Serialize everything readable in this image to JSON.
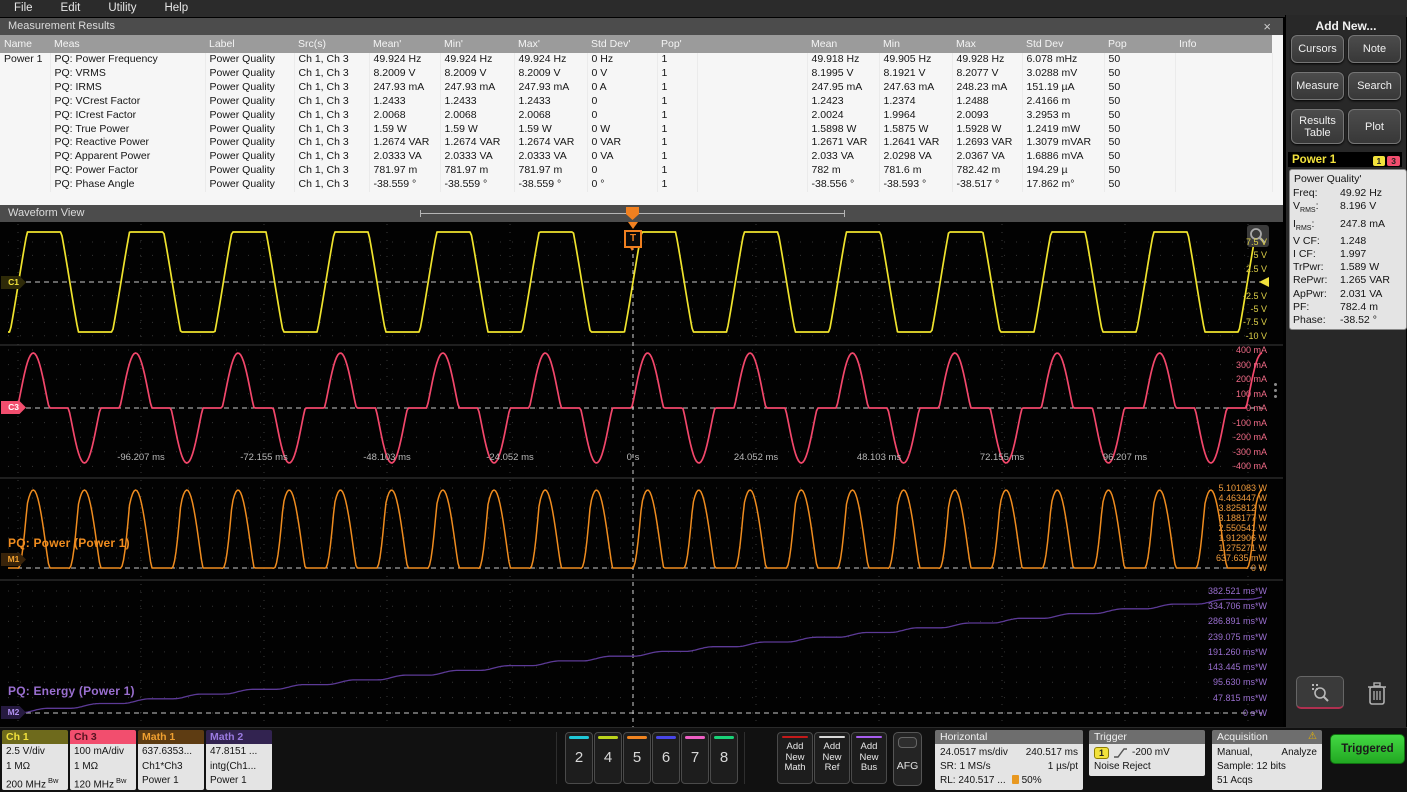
{
  "menu": {
    "items": [
      "File",
      "Edit",
      "Utility",
      "Help"
    ]
  },
  "results_panel": {
    "title": "Measurement Results",
    "close_label": "×",
    "columns": [
      "Name",
      "Meas",
      "Label",
      "Src(s)",
      "Mean'",
      "Min'",
      "Max'",
      "Std Dev'",
      "Pop'",
      "",
      "Mean",
      "Min",
      "Max",
      "Std Dev",
      "Pop",
      "Info"
    ],
    "rows": [
      [
        "Power 1",
        "PQ: Power Frequency",
        "Power Quality",
        "Ch 1, Ch 3",
        "49.924 Hz",
        "49.924 Hz",
        "49.924 Hz",
        "0 Hz",
        "1",
        "",
        "49.918 Hz",
        "49.905 Hz",
        "49.928 Hz",
        "6.078 mHz",
        "50",
        ""
      ],
      [
        "",
        "PQ: VRMS",
        "Power Quality",
        "Ch 1, Ch 3",
        "8.2009 V",
        "8.2009 V",
        "8.2009 V",
        "0 V",
        "1",
        "",
        "8.1995 V",
        "8.1921 V",
        "8.2077 V",
        "3.0288 mV",
        "50",
        ""
      ],
      [
        "",
        "PQ: IRMS",
        "Power Quality",
        "Ch 1, Ch 3",
        "247.93 mA",
        "247.93 mA",
        "247.93 mA",
        "0 A",
        "1",
        "",
        "247.95 mA",
        "247.63 mA",
        "248.23 mA",
        "151.19 µA",
        "50",
        ""
      ],
      [
        "",
        "PQ: VCrest Factor",
        "Power Quality",
        "Ch 1, Ch 3",
        "1.2433",
        "1.2433",
        "1.2433",
        "0",
        "1",
        "",
        "1.2423",
        "1.2374",
        "1.2488",
        "2.4166 m",
        "50",
        ""
      ],
      [
        "",
        "PQ: ICrest Factor",
        "Power Quality",
        "Ch 1, Ch 3",
        "2.0068",
        "2.0068",
        "2.0068",
        "0",
        "1",
        "",
        "2.0024",
        "1.9964",
        "2.0093",
        "3.2953 m",
        "50",
        ""
      ],
      [
        "",
        "PQ: True Power",
        "Power Quality",
        "Ch 1, Ch 3",
        "1.59 W",
        "1.59 W",
        "1.59 W",
        "0 W",
        "1",
        "",
        "1.5898 W",
        "1.5875 W",
        "1.5928 W",
        "1.2419 mW",
        "50",
        ""
      ],
      [
        "",
        "PQ: Reactive Power",
        "Power Quality",
        "Ch 1, Ch 3",
        "1.2674 VAR",
        "1.2674 VAR",
        "1.2674 VAR",
        "0 VAR",
        "1",
        "",
        "1.2671 VAR",
        "1.2641 VAR",
        "1.2693 VAR",
        "1.3079 mVAR",
        "50",
        ""
      ],
      [
        "",
        "PQ: Apparent Power",
        "Power Quality",
        "Ch 1, Ch 3",
        "2.0333 VA",
        "2.0333 VA",
        "2.0333 VA",
        "0 VA",
        "1",
        "",
        "2.033 VA",
        "2.0298 VA",
        "2.0367 VA",
        "1.6886 mVA",
        "50",
        ""
      ],
      [
        "",
        "PQ: Power Factor",
        "Power Quality",
        "Ch 1, Ch 3",
        "781.97 m",
        "781.97 m",
        "781.97 m",
        "0",
        "1",
        "",
        "782 m",
        "781.6 m",
        "782.42 m",
        "194.29 µ",
        "50",
        ""
      ],
      [
        "",
        "PQ: Phase Angle",
        "Power Quality",
        "Ch 1, Ch 3",
        "-38.559 °",
        "-38.559 °",
        "-38.559 °",
        "0 °",
        "1",
        "",
        "-38.556 °",
        "-38.593 °",
        "-38.517 °",
        "17.862 m°",
        "50",
        ""
      ]
    ]
  },
  "waveform_view": {
    "title": "Waveform View",
    "trigger_tag": "T",
    "channel_tags": [
      "C1",
      "C3",
      "M1",
      "M2"
    ],
    "power_trace_label": "PQ: Power (Power 1)",
    "energy_trace_label": "PQ: Energy (Power 1)"
  },
  "chart_data": [
    {
      "trace": "Ch 1 voltage",
      "type": "line",
      "color": "#efe32d",
      "shape": "trapezoid (clipped sine)",
      "frequency_hz": 49.92,
      "cycles_visible": 12,
      "volts_per_div": "2.5 V/div",
      "y_ticks": [
        "7.5 V",
        "5 V",
        "2.5 V",
        "-2.5 V",
        "-5 V",
        "-7.5 V",
        "-10 V"
      ],
      "zero_line": "0 V (dashed)"
    },
    {
      "trace": "Ch 3 current",
      "type": "line",
      "color": "#f2476b",
      "shape": "narrow alternating current pulses",
      "phase_lead_deg": 38.5,
      "y_ticks": [
        "400 mA",
        "300 mA",
        "200 mA",
        "100 mA",
        "0 mA",
        "-100 mA",
        "-200 mA",
        "-300 mA",
        "-400 mA"
      ],
      "x_ticks": [
        "-96.207 ms",
        "-72.155 ms",
        "-48.103 ms",
        "-24.052 ms",
        "0 s",
        "24.052 ms",
        "48.103 ms",
        "72.155 ms",
        "96.207 ms"
      ]
    },
    {
      "trace": "PQ: Power (Power 1)",
      "type": "line",
      "color": "#ef8c1f",
      "shape": "positive power humps, two per line cycle",
      "peak_w": 5.101083,
      "y_ticks": [
        "5.101083 W",
        "4.463447 W",
        "3.825812 W",
        "3.188177 W",
        "2.550541 W",
        "1.912906 W",
        "1.275271 W",
        "637.635 mW",
        "0 W"
      ]
    },
    {
      "trace": "PQ: Energy (Power 1)",
      "type": "line",
      "color": "#9a6fd0",
      "shape": "monotonic energy ramp from 0 to ~382.5 ms*W",
      "y_ticks": [
        "382.521 ms*W",
        "334.706 ms*W",
        "286.891 ms*W",
        "239.075 ms*W",
        "191.260 ms*W",
        "143.445 ms*W",
        "95.630 ms*W",
        "47.815 ms*W",
        "0 s*W"
      ]
    }
  ],
  "sidebar": {
    "title": "Add New...",
    "buttons": [
      "Cursors",
      "Note",
      "Measure",
      "Search",
      "Results\nTable",
      "Plot"
    ],
    "power_badge": {
      "name": "Power 1",
      "tags": [
        {
          "label": "1",
          "color": "#f2e23c"
        },
        {
          "label": "3",
          "color": "#f24e6e"
        }
      ]
    },
    "readout": {
      "title": "Power Quality'",
      "rows": [
        [
          "Freq:",
          "",
          "49.92 Hz"
        ],
        [
          "V",
          "RMS",
          "8.196 V"
        ],
        [
          "I",
          "RMS",
          "247.8 mA"
        ],
        [
          "V CF:",
          "",
          "1.248"
        ],
        [
          "I CF:",
          "",
          "1.997"
        ],
        [
          "TrPwr:",
          "",
          "1.589 W"
        ],
        [
          "RePwr:",
          "",
          "1.265 VAR"
        ],
        [
          "ApPwr:",
          "",
          "2.031 VA"
        ],
        [
          "PF:",
          "",
          "782.4 m"
        ],
        [
          "Phase:",
          "",
          "-38.52 °"
        ]
      ]
    }
  },
  "bottom_bar": {
    "channels": [
      {
        "name": "Ch 1",
        "header_bg": "#6e6a1c",
        "header_fg": "#f2e23c",
        "lines": [
          "2.5 V/div",
          "1 MΩ",
          "200 MHz"
        ],
        "bw": "Bw"
      },
      {
        "name": "Ch 3",
        "header_bg": "#f24e6e",
        "header_fg": "#571320",
        "lines": [
          "100 mA/div",
          "1 MΩ",
          "120 MHz"
        ],
        "bw": "Bw"
      },
      {
        "name": "Math 1",
        "header_bg": "#5e3c12",
        "header_fg": "#f0a030",
        "lines": [
          "637.6353...",
          "Ch1*Ch3",
          "Power 1"
        ],
        "bw": ""
      },
      {
        "name": "Math 2",
        "header_bg": "#322350",
        "header_fg": "#9a7ae0",
        "lines": [
          "47.8151 ...",
          "intg(Ch1...",
          "Power 1"
        ],
        "bw": ""
      }
    ],
    "inactive_channels": [
      {
        "label": "2",
        "color": "#1fc8d8"
      },
      {
        "label": "4",
        "color": "#bcd41c"
      },
      {
        "label": "5",
        "color": "#f08420"
      },
      {
        "label": "6",
        "color": "#4846e8"
      },
      {
        "label": "7",
        "color": "#ee5fc4"
      },
      {
        "label": "8",
        "color": "#19d278"
      }
    ],
    "add_new_buttons": [
      {
        "lines": "Add\nNew\nMath",
        "color": "#c41a1a"
      },
      {
        "lines": "Add\nNew\nRef",
        "color": "#d8d8d8"
      },
      {
        "lines": "Add\nNew\nBus",
        "color": "#a85ef0"
      }
    ],
    "afg_label": "AFG",
    "horizontal": {
      "title": "Horizontal",
      "scale": "24.0517 ms/div",
      "duration": "240.517 ms",
      "sample_rate": "SR: 1 MS/s",
      "resolution": "1 µs/pt",
      "record_length": "RL: 240.517 ...",
      "position": "50%"
    },
    "trigger": {
      "title": "Trigger",
      "source": "1",
      "level": "-200 mV",
      "mode": "Noise Reject"
    },
    "acquisition": {
      "title": "Acquisition",
      "warning": "⚠",
      "mode": "Manual,",
      "analyze": "Analyze",
      "sample": "Sample: 12 bits",
      "acqs": "51 Acqs"
    },
    "triggered_label": "Triggered"
  }
}
